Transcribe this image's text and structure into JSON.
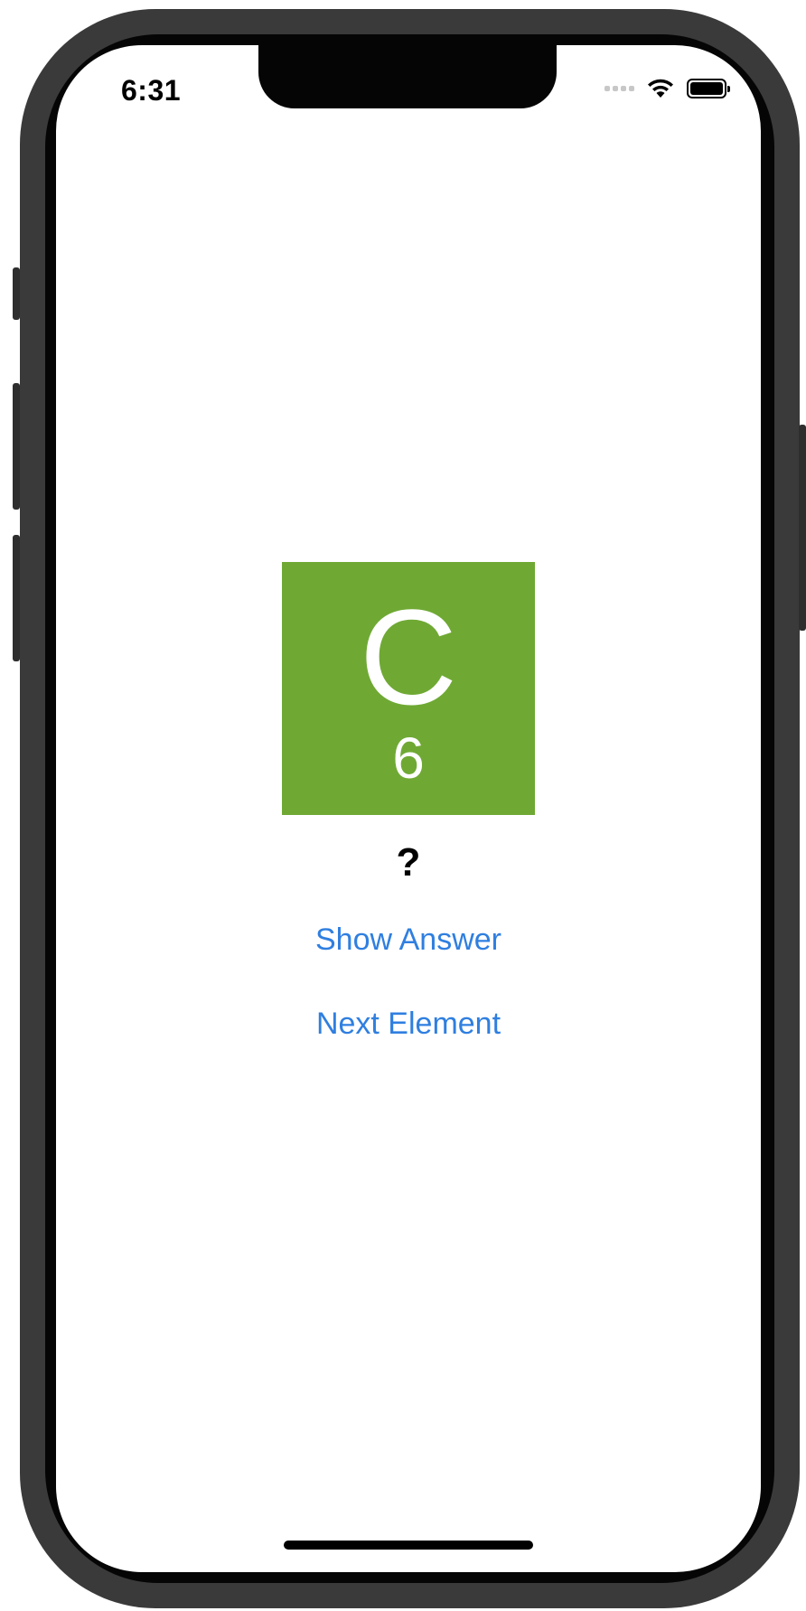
{
  "status_bar": {
    "time": "6:31",
    "icons": [
      "cellular-signal-icon",
      "wifi-icon",
      "battery-icon"
    ]
  },
  "element": {
    "symbol": "C",
    "atomic_number": "6",
    "tile_color": "#6fa934"
  },
  "answer_text": "?",
  "buttons": {
    "show_answer": "Show Answer",
    "next_element": "Next Element"
  },
  "colors": {
    "accent": "#2f7fe0"
  }
}
